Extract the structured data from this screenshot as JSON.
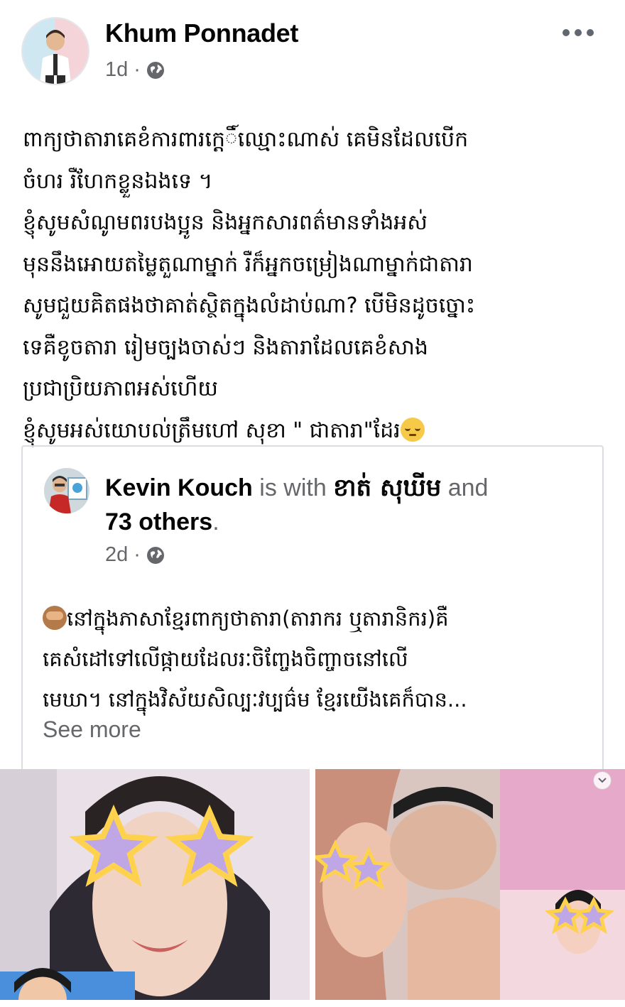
{
  "post": {
    "author": "Khum Ponnadet",
    "time": "1d",
    "separator": "·",
    "privacy_icon": "globe-icon",
    "more_icon": "more-horizontal-icon",
    "text_lines": [
      "ពាក្យថាតារាគេខំការពារកេ្តិ៍ឈ្មោះណាស់ គេមិនដែលបើក",
      "ចំហរ រឺហែកខ្លួនឯងទេ ។",
      "ខ្ញុំសូមសំណូមពរបងប្អូន និងអ្នកសារពត៌មានទាំងអស់",
      "មុននឹងអោយតម្លៃតួណាម្នាក់ រឺក៏អ្នកចម្រៀងណាម្នាក់ជាតារា",
      "សូមជួយគិតផងថាគាត់ស្ថិតក្នុងលំដាប់ណា?  បើមិនដូចច្នោះ",
      "ទេគឺខូចតារា រៀមច្បងចាស់ៗ និងតារាដែលគេខំសាង",
      "ប្រជាប្រិយភាពអស់ហើយ",
      "ខ្ញុំសូមអស់យោបល់ត្រឹមហៅ សុខា \" ជាតារា\"ដែរ"
    ],
    "trailing_emoji": "pensive-face-icon"
  },
  "shared": {
    "author": "Kevin Kouch",
    "with_text": " is with ",
    "tagged": "ខាត់ សុឃីម",
    "and_text": " and",
    "others": "73 others",
    "period": ".",
    "time": "2d",
    "separator": "·",
    "privacy_icon": "globe-icon",
    "leading_emoji": "see-no-evil-monkey-icon",
    "text_lines": [
      "នៅក្នុងភាសាខ្មែរពាក្យថាតារា(តារាករ ឬតារានិករ)គឺ",
      "គេសំដៅទៅលើផ្កាយដែលរៈចិញ្ចែងចិញ្ចាចនៅលើ",
      "មេឃា។ នៅក្នុងវិស័យសិល្បៈវប្បធ៌ម ខ្មែរយើងគេក៏បាន..."
    ],
    "see_more": "See more"
  },
  "media": [
    {
      "name": "video-thumbnail-left",
      "icon": "chevron-down-icon"
    },
    {
      "name": "video-thumbnail-right",
      "icon": "chevron-down-icon"
    }
  ],
  "colors": {
    "primary_text": "#050505",
    "secondary_text": "#65676b",
    "border": "#dadde1"
  }
}
